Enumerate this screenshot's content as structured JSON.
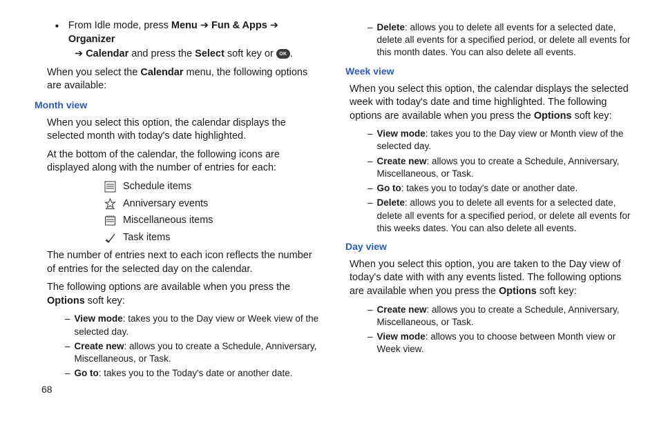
{
  "pageNumber": "68",
  "intro": {
    "prefix": "From Idle mode, press ",
    "menu": "Menu",
    "funApps": "Fun & Apps",
    "organizer": "Organizer",
    "calendar": "Calendar",
    "mid": " and press the ",
    "select": "Select",
    "suffix1": " soft key or ",
    "ok": "OK",
    "suffix2": "."
  },
  "whenSelectPrefix": "When you select the ",
  "whenSelectBold": "Calendar",
  "whenSelectSuffix": " menu, the following options are available:",
  "monthView": {
    "heading": "Month view",
    "p1": "When you select this option, the calendar displays the selected month with today's date highlighted.",
    "p2": "At the bottom of the calendar, the following icons are displayed along with the number of entries for each:",
    "icons": {
      "schedule": "Schedule items",
      "anniversary": "Anniversary events",
      "misc": "Miscellaneous items",
      "task": "Task items"
    },
    "p3": "The number of entries next to each icon reflects the number of entries for the selected day on the calendar.",
    "p4a": "The following options are available when you press the ",
    "p4b": "Options",
    "p4c": " soft key:",
    "opts": [
      {
        "t": "View mode",
        "d": ": takes you to the Day view or Week view of the selected day."
      },
      {
        "t": "Create new",
        "d": ": allows you to create a Schedule, Anniversary, Miscellaneous, or Task."
      },
      {
        "t": "Go to",
        "d": ": takes you to the Today's date or another date."
      },
      {
        "t": "Delete",
        "d": ": allows you to delete all events for a selected date, delete all events for a specified period, or delete all events for this month dates. You can also delete all events."
      }
    ]
  },
  "weekView": {
    "heading": "Week view",
    "p1a": "When you select this option, the calendar displays the selected week with today's date and time highlighted. The following options are available when you press the ",
    "p1b": "Options",
    "p1c": " soft key:",
    "opts": [
      {
        "t": "View mode",
        "d": ": takes you to the Day view or Month view of the selected day."
      },
      {
        "t": "Create new",
        "d": ": allows you to create a Schedule, Anniversary, Miscellaneous, or Task."
      },
      {
        "t": "Go to",
        "d": ": takes you to today's date or another date."
      },
      {
        "t": "Delete",
        "d": ": allows you to delete all events for a selected date, delete all events for a specified period, or delete all events for this weeks dates. You can also delete all events."
      }
    ]
  },
  "dayView": {
    "heading": "Day view",
    "p1a": "When you select this option, you are taken to the Day view of today's date with with any events listed. The following options are available when you press the ",
    "p1b": "Options",
    "p1c": " soft key:",
    "opts": [
      {
        "t": "Create new",
        "d": ": allows you to create a Schedule, Anniversary, Miscellaneous, or Task."
      },
      {
        "t": "View mode",
        "d": ": allows you to choose between Month view or Week view."
      }
    ]
  }
}
